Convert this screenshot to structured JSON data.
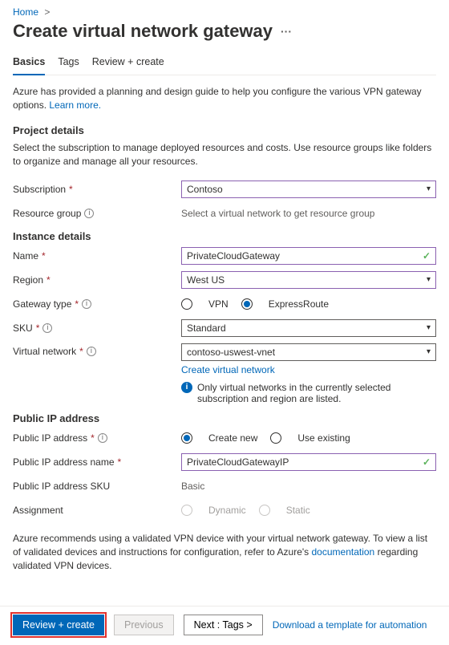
{
  "breadcrumb": {
    "home": "Home"
  },
  "title": "Create virtual network gateway",
  "tabs": {
    "basics": "Basics",
    "tags": "Tags",
    "review": "Review + create"
  },
  "intro": {
    "text": "Azure has provided a planning and design guide to help you configure the various VPN gateway options.  ",
    "learn": "Learn more."
  },
  "project": {
    "heading": "Project details",
    "desc": "Select the subscription to manage deployed resources and costs. Use resource groups like folders to organize and manage all your resources.",
    "subscription_label": "Subscription",
    "subscription_value": "Contoso",
    "rg_label": "Resource group",
    "rg_hint": "Select a virtual network to get resource group"
  },
  "instance": {
    "heading": "Instance details",
    "name_label": "Name",
    "name_value": "PrivateCloudGateway",
    "region_label": "Region",
    "region_value": "West US",
    "gwtype_label": "Gateway type",
    "gwtype_vpn": "VPN",
    "gwtype_er": "ExpressRoute",
    "sku_label": "SKU",
    "sku_value": "Standard",
    "vnet_label": "Virtual network",
    "vnet_value": "contoso-uswest-vnet",
    "create_vnet": "Create virtual network",
    "vnet_info": "Only virtual networks in the currently selected subscription and region are listed."
  },
  "pubip": {
    "heading": "Public IP address",
    "addr_label": "Public IP address",
    "create_new": "Create new",
    "use_existing": "Use existing",
    "name_label": "Public IP address name",
    "name_value": "PrivateCloudGatewayIP",
    "sku_label": "Public IP address SKU",
    "sku_value": "Basic",
    "assign_label": "Assignment",
    "dynamic": "Dynamic",
    "static": "Static"
  },
  "recommend": {
    "pre": "Azure recommends using a validated VPN device with your virtual network gateway. To view a list of validated devices and instructions for configuration, refer to Azure's ",
    "link": "documentation",
    "post": " regarding validated VPN devices."
  },
  "footer": {
    "review": "Review + create",
    "previous": "Previous",
    "next": "Next : Tags >",
    "download": "Download a template for automation"
  }
}
